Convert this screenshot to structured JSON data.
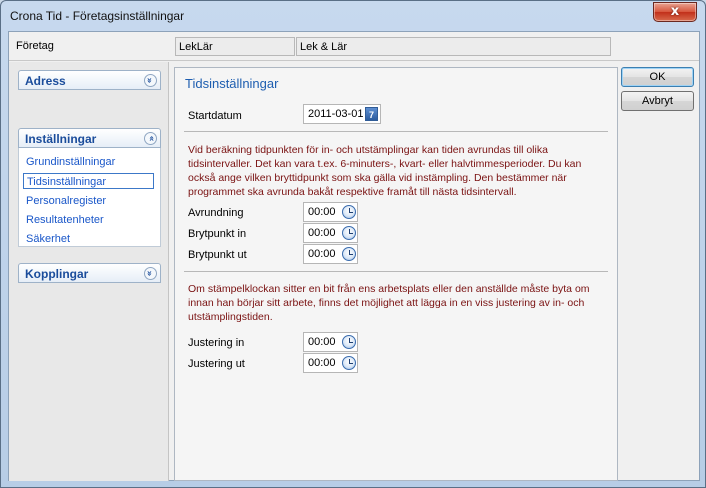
{
  "window": {
    "title": "Crona Tid - Företagsinställningar",
    "close_glyph": "x"
  },
  "company": {
    "label": "Företag",
    "code": "LekLär",
    "name": "Lek & Lär"
  },
  "sidebar": {
    "sections": [
      {
        "label": "Adress",
        "state": "collapsed",
        "chevron": "«"
      },
      {
        "label": "Inställningar",
        "state": "expanded",
        "chevron": "«"
      },
      {
        "label": "Kopplingar",
        "state": "collapsed",
        "chevron": "«"
      }
    ],
    "items": [
      {
        "label": "Grundinställningar",
        "selected": false
      },
      {
        "label": "Tidsinställningar",
        "selected": true
      },
      {
        "label": "Personalregister",
        "selected": false
      },
      {
        "label": "Resultatenheter",
        "selected": false
      },
      {
        "label": "Säkerhet",
        "selected": false
      }
    ]
  },
  "panel": {
    "title": "Tidsinställningar",
    "start_date": {
      "label": "Startdatum",
      "value": "2011-03-01",
      "icon": "calendar-icon",
      "icon_glyph": "7"
    },
    "info1": "Vid beräkning tidpunkten för in- och utstämplingar kan tiden avrundas till olika tidsintervaller. Det kan vara t.ex. 6-minuters-, kvart- eller halvtimmesperioder. Du kan också ange vilken bryttidpunkt som ska gälla vid instämpling. Den bestämmer när programmet ska avrunda bakåt respektive framåt till nästa tidsintervall.",
    "rounding": {
      "label": "Avrundning",
      "value": "00:00"
    },
    "break_in": {
      "label": "Brytpunkt in",
      "value": "00:00"
    },
    "break_out": {
      "label": "Brytpunkt ut",
      "value": "00:00"
    },
    "info2": "Om stämpelklockan sitter en bit från ens arbetsplats eller den anställde måste byta om innan han börjar sitt arbete, finns det möjlighet att lägga in en viss justering av in- och utstämplingstiden.",
    "adjust_in": {
      "label": "Justering in",
      "value": "00:00"
    },
    "adjust_out": {
      "label": "Justering ut",
      "value": "00:00"
    }
  },
  "buttons": {
    "ok": "OK",
    "cancel": "Avbryt"
  },
  "colors": {
    "accent": "#1a4c9b",
    "info_text": "#7a1212",
    "link": "#1a57c9"
  }
}
